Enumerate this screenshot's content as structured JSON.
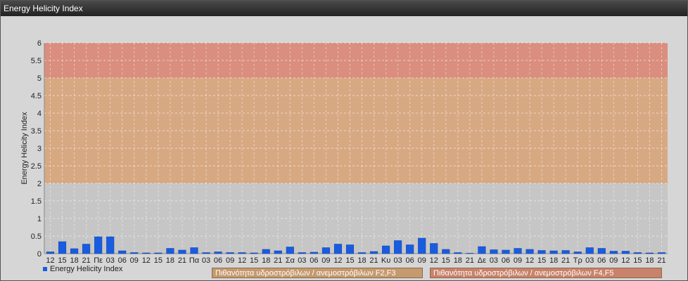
{
  "window": {
    "title": "Energy Helicity Index"
  },
  "chart_data": {
    "type": "bar",
    "ylabel": "Energy Helicity Index",
    "ylim": [
      0,
      6
    ],
    "yticks": [
      "0",
      "0.5",
      "1",
      "1.5",
      "2",
      "2.5",
      "3",
      "3.5",
      "4",
      "4.5",
      "5",
      "5.5",
      "6"
    ],
    "categories": [
      "12",
      "15",
      "18",
      "21",
      "Πε",
      "03",
      "06",
      "09",
      "12",
      "15",
      "18",
      "21",
      "Πα",
      "03",
      "06",
      "09",
      "12",
      "15",
      "18",
      "21",
      "Σα",
      "03",
      "06",
      "09",
      "12",
      "15",
      "18",
      "21",
      "Κυ",
      "03",
      "06",
      "09",
      "12",
      "15",
      "18",
      "21",
      "Δε",
      "03",
      "06",
      "09",
      "12",
      "15",
      "18",
      "21",
      "Τρ",
      "03",
      "06",
      "09",
      "12",
      "15",
      "18",
      "21"
    ],
    "series": [
      {
        "name": "Energy Helicity Index",
        "color": "#1a5ce0",
        "values": [
          0.05,
          0.34,
          0.14,
          0.27,
          0.48,
          0.48,
          0.08,
          0.03,
          0.02,
          0.02,
          0.15,
          0.1,
          0.17,
          0.03,
          0.05,
          0.03,
          0.03,
          0.02,
          0.12,
          0.08,
          0.19,
          0.03,
          0.04,
          0.17,
          0.27,
          0.25,
          0.03,
          0.06,
          0.22,
          0.37,
          0.25,
          0.44,
          0.29,
          0.12,
          0.03,
          0.01,
          0.2,
          0.11,
          0.1,
          0.15,
          0.12,
          0.09,
          0.08,
          0.09,
          0.05,
          0.17,
          0.15,
          0.07,
          0.07,
          0.03,
          0.02,
          0.03
        ]
      }
    ],
    "zones": [
      {
        "from": 0,
        "to": 2,
        "color": "#c4c4c4"
      },
      {
        "from": 2,
        "to": 5,
        "color": "#d7a47a"
      },
      {
        "from": 5,
        "to": 6,
        "color": "#da8674"
      }
    ],
    "zone_legend": [
      {
        "label": "Πιθανότητα υδροστρόβιλων / ανεμοστρόβιλων F2,F3"
      },
      {
        "label": "Πιθανότητα υδροστρόβιλων / ανεμοστρόβιλων F4,F5"
      }
    ],
    "grid": true,
    "legend_position": "bottom-left"
  }
}
